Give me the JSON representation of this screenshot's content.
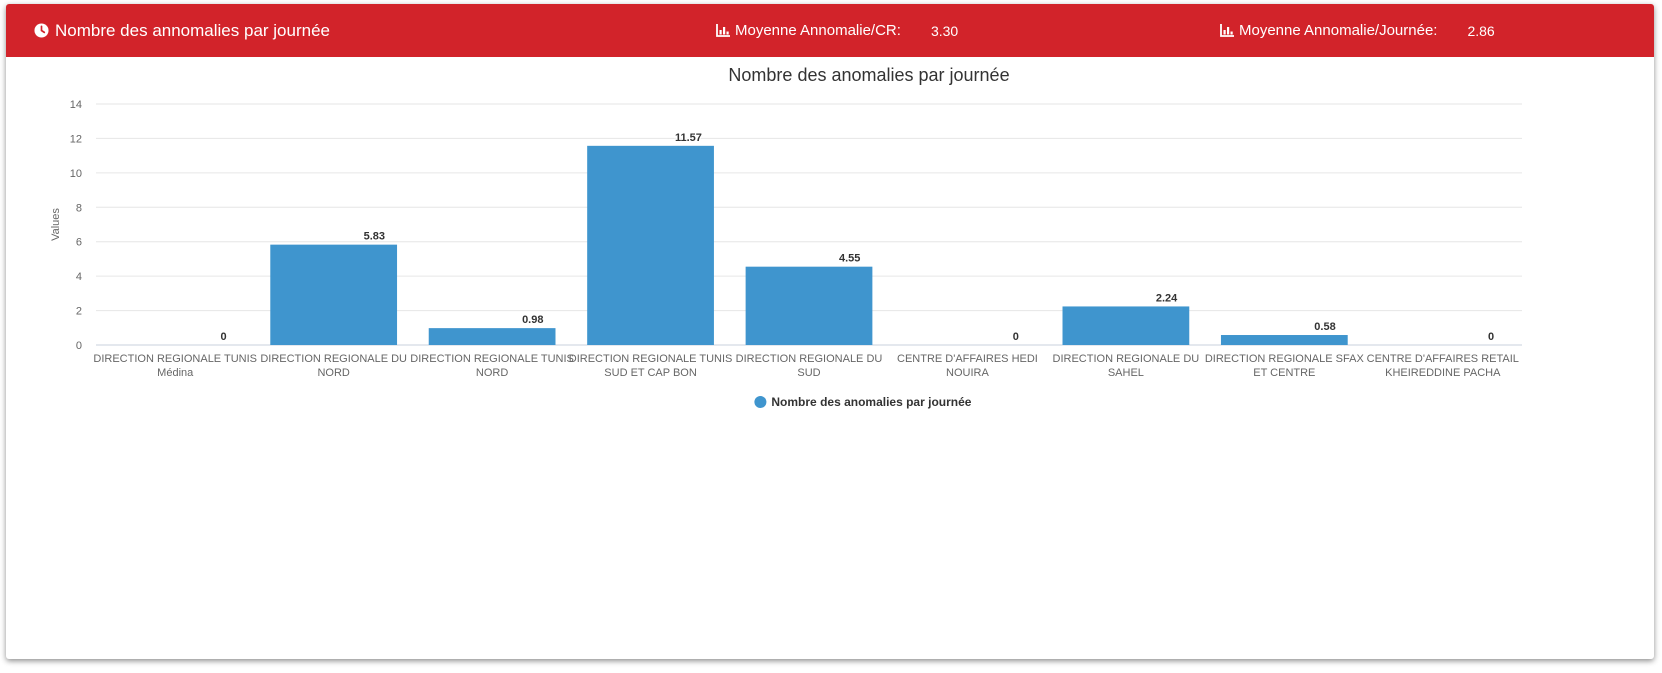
{
  "header": {
    "title": "Nombre des annomalies par journée",
    "stat_cr_label": "Moyenne Annomalie/CR:",
    "stat_cr_value": "3.30",
    "stat_day_label": "Moyenne Annomalie/Journée:",
    "stat_day_value": "2.86",
    "title_icon": "clock-icon",
    "stat_icon": "bar-chart-icon",
    "background_color": "#d2232a"
  },
  "chart_data": {
    "type": "bar",
    "title": "Nombre des anomalies par journée",
    "ylabel": "Values",
    "xlabel": "",
    "ylim": [
      0,
      14
    ],
    "yticks": [
      0,
      2,
      4,
      6,
      8,
      10,
      12,
      14
    ],
    "grid": true,
    "legend_position": "bottom",
    "bar_color": "#3f95ce",
    "categories": [
      [
        "DIRECTION REGIONALE TUNIS",
        "Médina"
      ],
      [
        "DIRECTION REGIONALE DU",
        "NORD"
      ],
      [
        "DIRECTION REGIONALE TUNIS",
        "NORD"
      ],
      [
        "DIRECTION REGIONALE TUNIS",
        "SUD ET CAP BON"
      ],
      [
        "DIRECTION REGIONALE DU",
        "SUD"
      ],
      [
        "CENTRE D'AFFAIRES HEDI",
        "NOUIRA"
      ],
      [
        "DIRECTION REGIONALE DU",
        "SAHEL"
      ],
      [
        "DIRECTION REGIONALE SFAX",
        "ET CENTRE"
      ],
      [
        "CENTRE D'AFFAIRES RETAIL",
        "KHEIREDDINE PACHA"
      ]
    ],
    "series": [
      {
        "name": "Nombre des anomalies par journée",
        "values": [
          0,
          5.83,
          0.98,
          11.57,
          4.55,
          0,
          2.24,
          0.58,
          0
        ],
        "labels": [
          "0",
          "5.83",
          "0.98",
          "11.57",
          "4.55",
          "0",
          "2.24",
          "0.58",
          "0"
        ]
      }
    ]
  }
}
